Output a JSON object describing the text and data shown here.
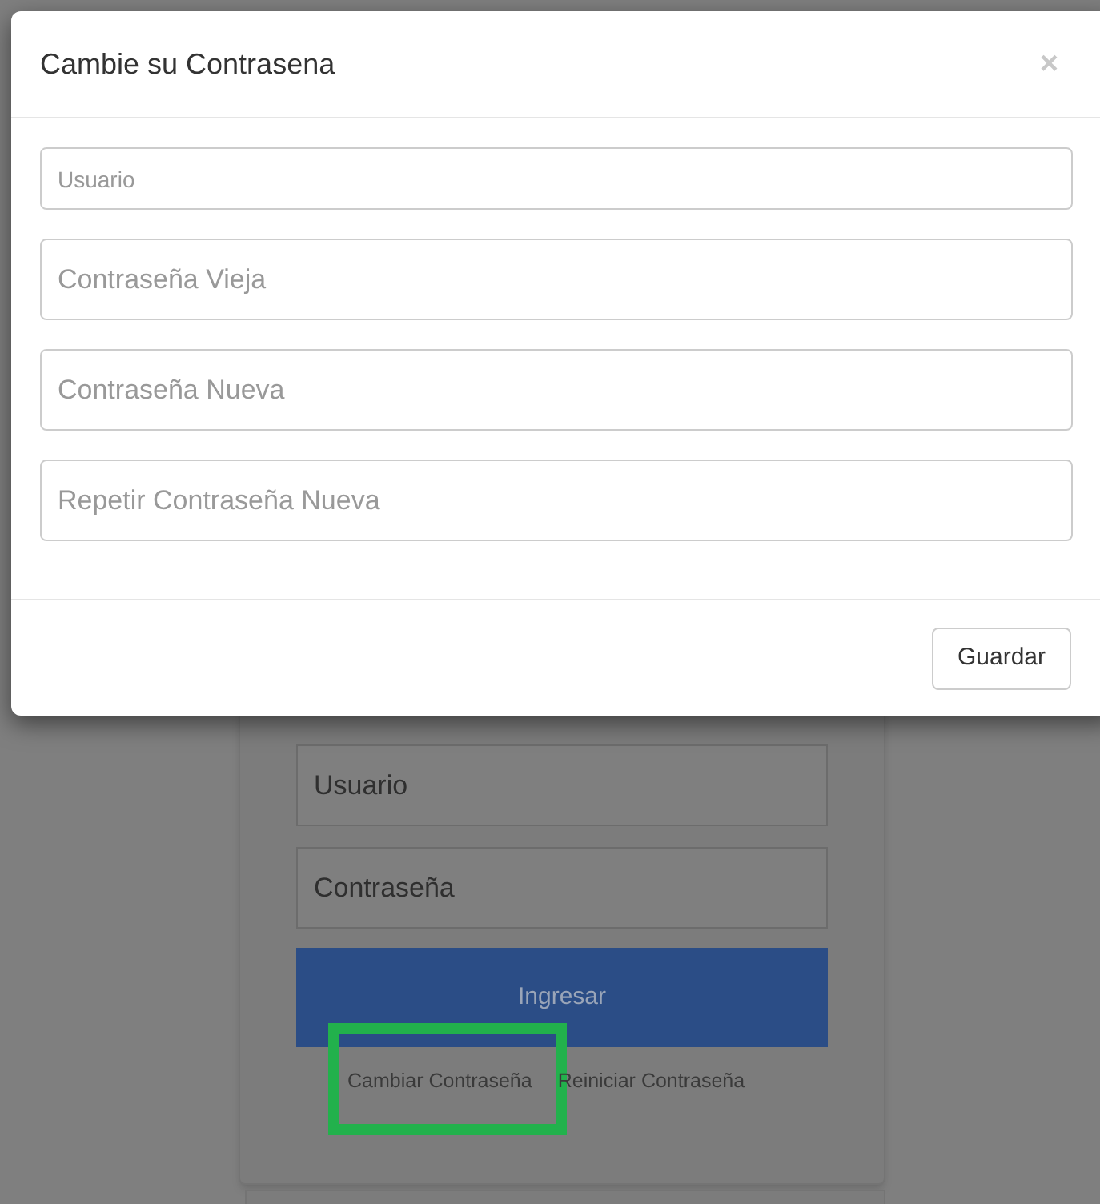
{
  "modal": {
    "title": "Cambie su Contrasena",
    "close": "×",
    "fields": [
      {
        "placeholder": "Usuario",
        "kind": "compact"
      },
      {
        "placeholder": "Contraseña Vieja",
        "kind": "regular"
      },
      {
        "placeholder": "Contraseña Nueva",
        "kind": "regular"
      },
      {
        "placeholder": "Repetir Contraseña Nueva",
        "kind": "regular"
      }
    ],
    "save_button": "Guardar"
  },
  "login": {
    "fields": [
      {
        "placeholder": "Usuario"
      },
      {
        "placeholder": "Contraseña"
      }
    ],
    "submit_button": "Ingresar",
    "links": [
      {
        "label": "Cambiar Contraseña",
        "highlighted": true
      },
      {
        "label": "Reiniciar Contraseña",
        "highlighted": false
      }
    ]
  }
}
